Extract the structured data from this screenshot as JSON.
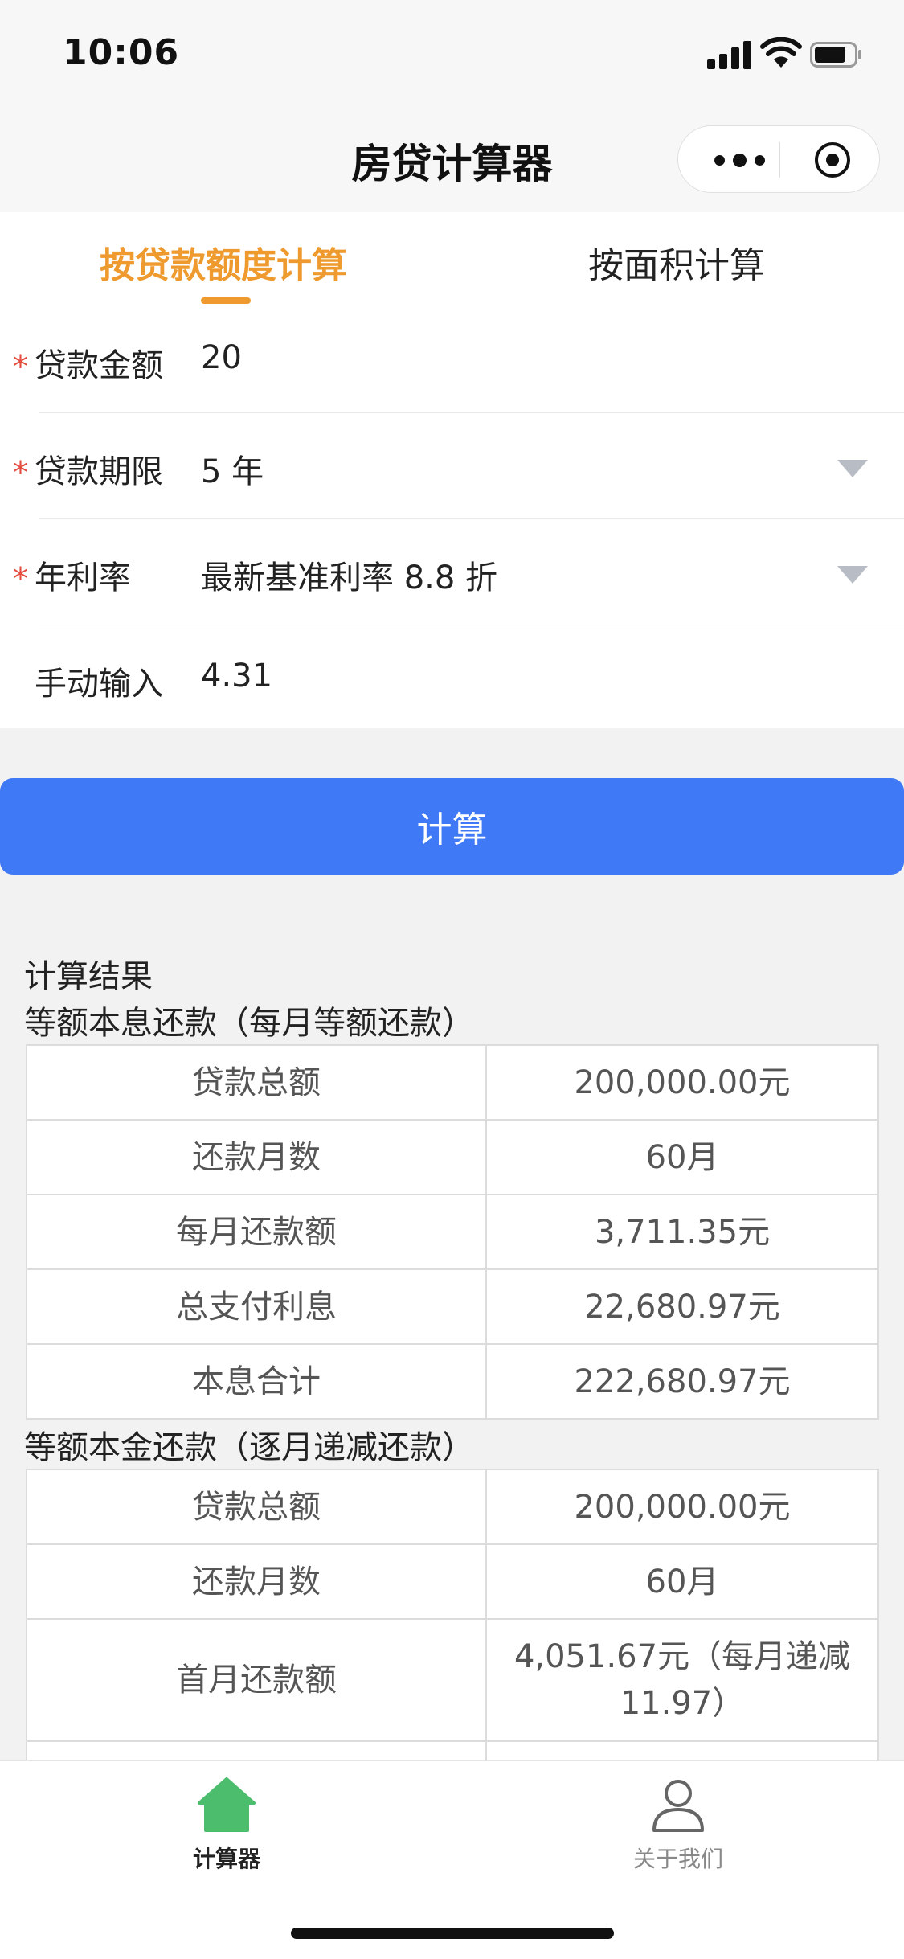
{
  "status_bar": {
    "time": "10:06"
  },
  "nav": {
    "title": "房贷计算器"
  },
  "tabs": [
    {
      "label": "按贷款额度计算",
      "active": true
    },
    {
      "label": "按面积计算",
      "active": false
    }
  ],
  "form": {
    "fields": [
      {
        "label": "贷款金额",
        "value": "20",
        "required": true
      },
      {
        "label": "贷款期限",
        "value": "5 年",
        "required": true
      },
      {
        "label": "年利率",
        "value": "最新基准利率 8.8 折",
        "required": true
      },
      {
        "label": "手动输入",
        "value": "4.31",
        "required": false
      }
    ],
    "required_mark": "*"
  },
  "calc_button": {
    "label": "计算"
  },
  "results": {
    "title": "计算结果",
    "equal_installment": {
      "title": "等额本息还款（每月等额还款）",
      "rows": [
        {
          "key": "贷款总额",
          "value": "200,000.00元"
        },
        {
          "key": "还款月数",
          "value": "60月"
        },
        {
          "key": "每月还款额",
          "value": "3,711.35元"
        },
        {
          "key": "总支付利息",
          "value": "22,680.97元"
        },
        {
          "key": "本息合计",
          "value": "222,680.97元"
        }
      ]
    },
    "equal_principal": {
      "title": "等额本金还款（逐月递减还款）",
      "rows": [
        {
          "key": "贷款总额",
          "value": "200,000.00元"
        },
        {
          "key": "还款月数",
          "value": "60月"
        },
        {
          "key": "首月还款额",
          "value": "4,051.67元（每月递减11.97）"
        }
      ]
    }
  },
  "tab_bar": [
    {
      "label": "计算器",
      "icon": "home-icon",
      "active": true
    },
    {
      "label": "关于我们",
      "icon": "user-icon",
      "active": false
    }
  ],
  "colors": {
    "accent": "#ee9a2e",
    "primary_button": "#4079f5",
    "required": "#e54d42",
    "home_icon": "#4cbd6c"
  }
}
